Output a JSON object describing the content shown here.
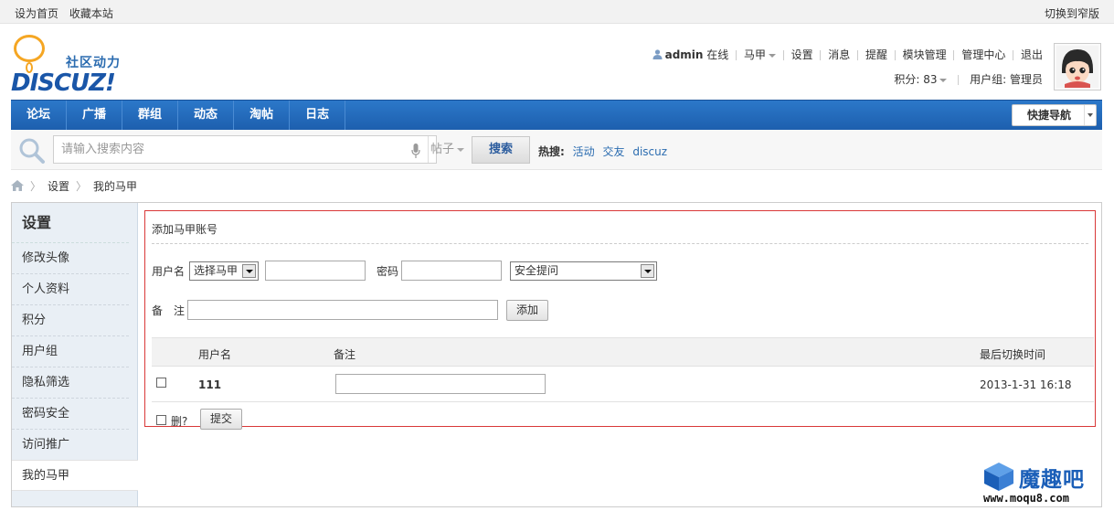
{
  "topbar": {
    "set_home": "设为首页",
    "bookmark": "收藏本站",
    "switch_width": "切换到窄版"
  },
  "logo": {
    "cn": "社区动力",
    "en": "DISCUZ!"
  },
  "user": {
    "name": "admin",
    "status": "在线",
    "vest": "马甲",
    "links": [
      "设置",
      "消息",
      "提醒",
      "模块管理",
      "管理中心",
      "退出"
    ],
    "points": "积分: 83",
    "group": "用户组: 管理员"
  },
  "nav": {
    "items": [
      "论坛",
      "广播",
      "群组",
      "动态",
      "淘帖",
      "日志"
    ],
    "quick_nav": "快捷导航"
  },
  "search": {
    "placeholder": "请输入搜索内容",
    "scope": "帖子",
    "button": "搜索",
    "hot_label": "热搜:",
    "hot": [
      "活动",
      "交友",
      "discuz"
    ]
  },
  "breadcrumb": [
    "设置",
    "我的马甲"
  ],
  "sidebar": {
    "title": "设置",
    "items": [
      "修改头像",
      "个人资料",
      "积分",
      "用户组",
      "隐私筛选",
      "密码安全",
      "访问推广",
      "我的马甲"
    ]
  },
  "form": {
    "title": "添加马甲账号",
    "username_label": "用户名",
    "select_vest": "选择马甲",
    "password_label": "密码",
    "security_question": "安全提问",
    "note_label": "备　注",
    "add_button": "添加"
  },
  "table": {
    "headers": {
      "username": "用户名",
      "note": "备注",
      "last_switch": "最后切换时间"
    },
    "rows": [
      {
        "username": "111",
        "note": "",
        "last_switch": "2013-1-31 16:18"
      }
    ],
    "delete_label": "删?",
    "submit_button": "提交"
  },
  "watermark": {
    "text": "魔趣吧",
    "url": "www.moqu8.com"
  },
  "colors": {
    "nav_bg": "#1d5fae",
    "accent": "#2b6cb0",
    "highlight_border": "#d93838"
  }
}
